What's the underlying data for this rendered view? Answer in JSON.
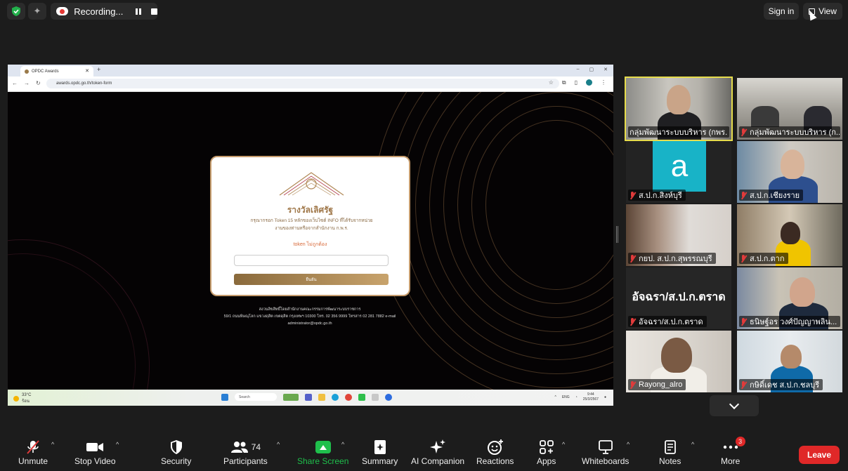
{
  "topbar": {
    "recording_label": "Recording...",
    "signin_label": "Sign in",
    "view_label": "View"
  },
  "shared_screen": {
    "tab_title": "OPDC Awards",
    "url": "awards.opdc.go.th/token-form",
    "card": {
      "logo_text": "เลิศรัฐ",
      "title": "รางวัลเลิศรัฐ",
      "description_line1": "กรุณากรอก Token 15 หลักของเว็บไซต์ INFO ที่ได้รับจากหน่วย",
      "description_line2": "งานของท่านหรือจากสำนักงาน ก.พ.ร.",
      "error": "token ไม่ถูกต้อง",
      "input_placeholder": "",
      "button_label": "ยืนยัน"
    },
    "footer": {
      "line1": "สงวนลิขสิทธิ์โดยสำนักงานคณะกรรมการพัฒนาระบบราชการ",
      "line2": "59/1 ถนนพิษณุโลก แขวงดุสิต เขตดุสิต กรุงเทพฯ 10300 โทร. 02 356 9999 โทรสาร 02 281 7882 e-mail",
      "line3": "administrator@opdc.go.th"
    },
    "taskbar": {
      "weather_temp": "33°C",
      "weather_desc": "ร้อน",
      "search_label": "Search",
      "lang": "ENG",
      "time": "9:44",
      "date": "25/3/2567"
    }
  },
  "participants": [
    {
      "name": "กลุ่มพัฒนาระบบบริหาร (กพร. ...",
      "muted": false,
      "active": true
    },
    {
      "name": "กลุ่มพัฒนาระบบบริหาร (ก...",
      "muted": true
    },
    {
      "name": "ส.ป.ก.สิงห์บุรี",
      "muted": true,
      "avatar_letter": "a"
    },
    {
      "name": "ส.ป.ก.เชียงราย",
      "muted": true
    },
    {
      "name": "กยป. ส.ป.ก.สุพรรณบุรี",
      "muted": true
    },
    {
      "name": "ส.ป.ก.ตาก",
      "muted": true
    },
    {
      "name": "อัจฉรา/ส.ป.ก.ตราด",
      "muted": true,
      "big_name": "อัจฉรา/ส.ป.ก.ตราด"
    },
    {
      "name": "ธนิษฐ์อร วงศ์ปัญญาพลิน...",
      "muted": true
    },
    {
      "name": "Rayong_alro",
      "muted": true
    },
    {
      "name": "กษิดิ์เดช ส.ป.ก.ชลบุรี",
      "muted": true
    }
  ],
  "toolbar": {
    "unmute": "Unmute",
    "stop_video": "Stop Video",
    "security": "Security",
    "participants": "Participants",
    "participants_count": "74",
    "share_screen": "Share Screen",
    "summary": "Summary",
    "ai_companion": "AI Companion",
    "reactions": "Reactions",
    "apps": "Apps",
    "whiteboards": "Whiteboards",
    "notes": "Notes",
    "more": "More",
    "more_badge": "3",
    "leave": "Leave"
  },
  "colors": {
    "share_green": "#1fbf4c",
    "leave_red": "#e02828",
    "active_speaker": "#e6dc4c",
    "card_gold": "#c69c6d"
  }
}
